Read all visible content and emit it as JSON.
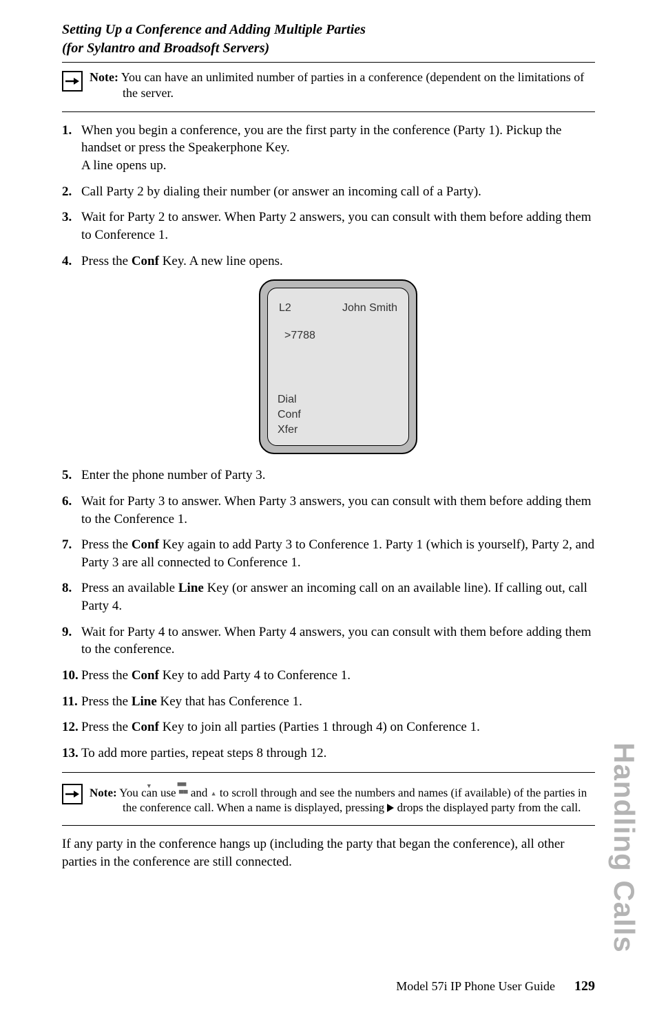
{
  "heading": {
    "line1": "Setting Up a Conference and Adding Multiple Parties",
    "line2": "(for Sylantro and Broadsoft Servers)"
  },
  "note1": {
    "label": "Note:",
    "text": " You can have an unlimited number of parties in a conference (dependent on the limitations of the server."
  },
  "steps": {
    "s1a": "When you begin a conference, you are the first party in the conference (Party 1). Pickup the handset or press the Speakerphone Key.",
    "s1b": "A line opens up.",
    "s2": "Call Party 2 by dialing their number (or answer an incoming call of a Party).",
    "s3": "Wait for Party 2 to answer. When Party 2 answers, you can consult with them before adding them to Conference 1.",
    "s4a": "Press the ",
    "s4key": "Conf",
    "s4b": " Key. A new line opens.",
    "s5": "Enter the phone number of Party 3.",
    "s6": "Wait for Party 3 to answer. When Party 3 answers, you can consult with them before adding them to the Conference 1.",
    "s7a": "Press the ",
    "s7key": "Conf",
    "s7b": " Key again to add Party 3 to Conference 1. Party 1 (which is yourself), Party 2, and Party 3 are all connected to Conference 1.",
    "s8a": "Press an available ",
    "s8key": "Line",
    "s8b": " Key (or answer an incoming call on an available line). If calling out, call Party 4.",
    "s9": "Wait for Party 4 to answer. When Party 4 answers, you can consult with them before adding them to the conference.",
    "s10a": "Press the ",
    "s10key": "Conf",
    "s10b": " Key to add Party 4 to Conference 1.",
    "s11a": "Press the ",
    "s11key": "Line",
    "s11b": " Key that has Conference 1.",
    "s12a": "Press the ",
    "s12key": "Conf",
    "s12b": " Key to join all parties (Parties 1 through 4) on Conference 1.",
    "s13": "To add more parties, repeat steps 8 through 12."
  },
  "phone": {
    "line_label": "L2",
    "caller": "John Smith",
    "dialed": ">7788",
    "soft1": "Dial",
    "soft2": "Conf",
    "soft3": "Xfer"
  },
  "note2": {
    "label": "Note:",
    "part1": " You can use ",
    "part2": " and ",
    "part3": " to scroll through and see the numbers and names (if available) of the parties in the conference call. When a name is displayed, pressing ",
    "part4": " drops the displayed party from the call."
  },
  "closing": "If any party in the conference hangs up (including the party that began the conference), all other parties in the conference are still connected.",
  "side_tab": "Handling Calls",
  "footer": {
    "title": "Model 57i IP Phone User Guide",
    "page": "129"
  }
}
